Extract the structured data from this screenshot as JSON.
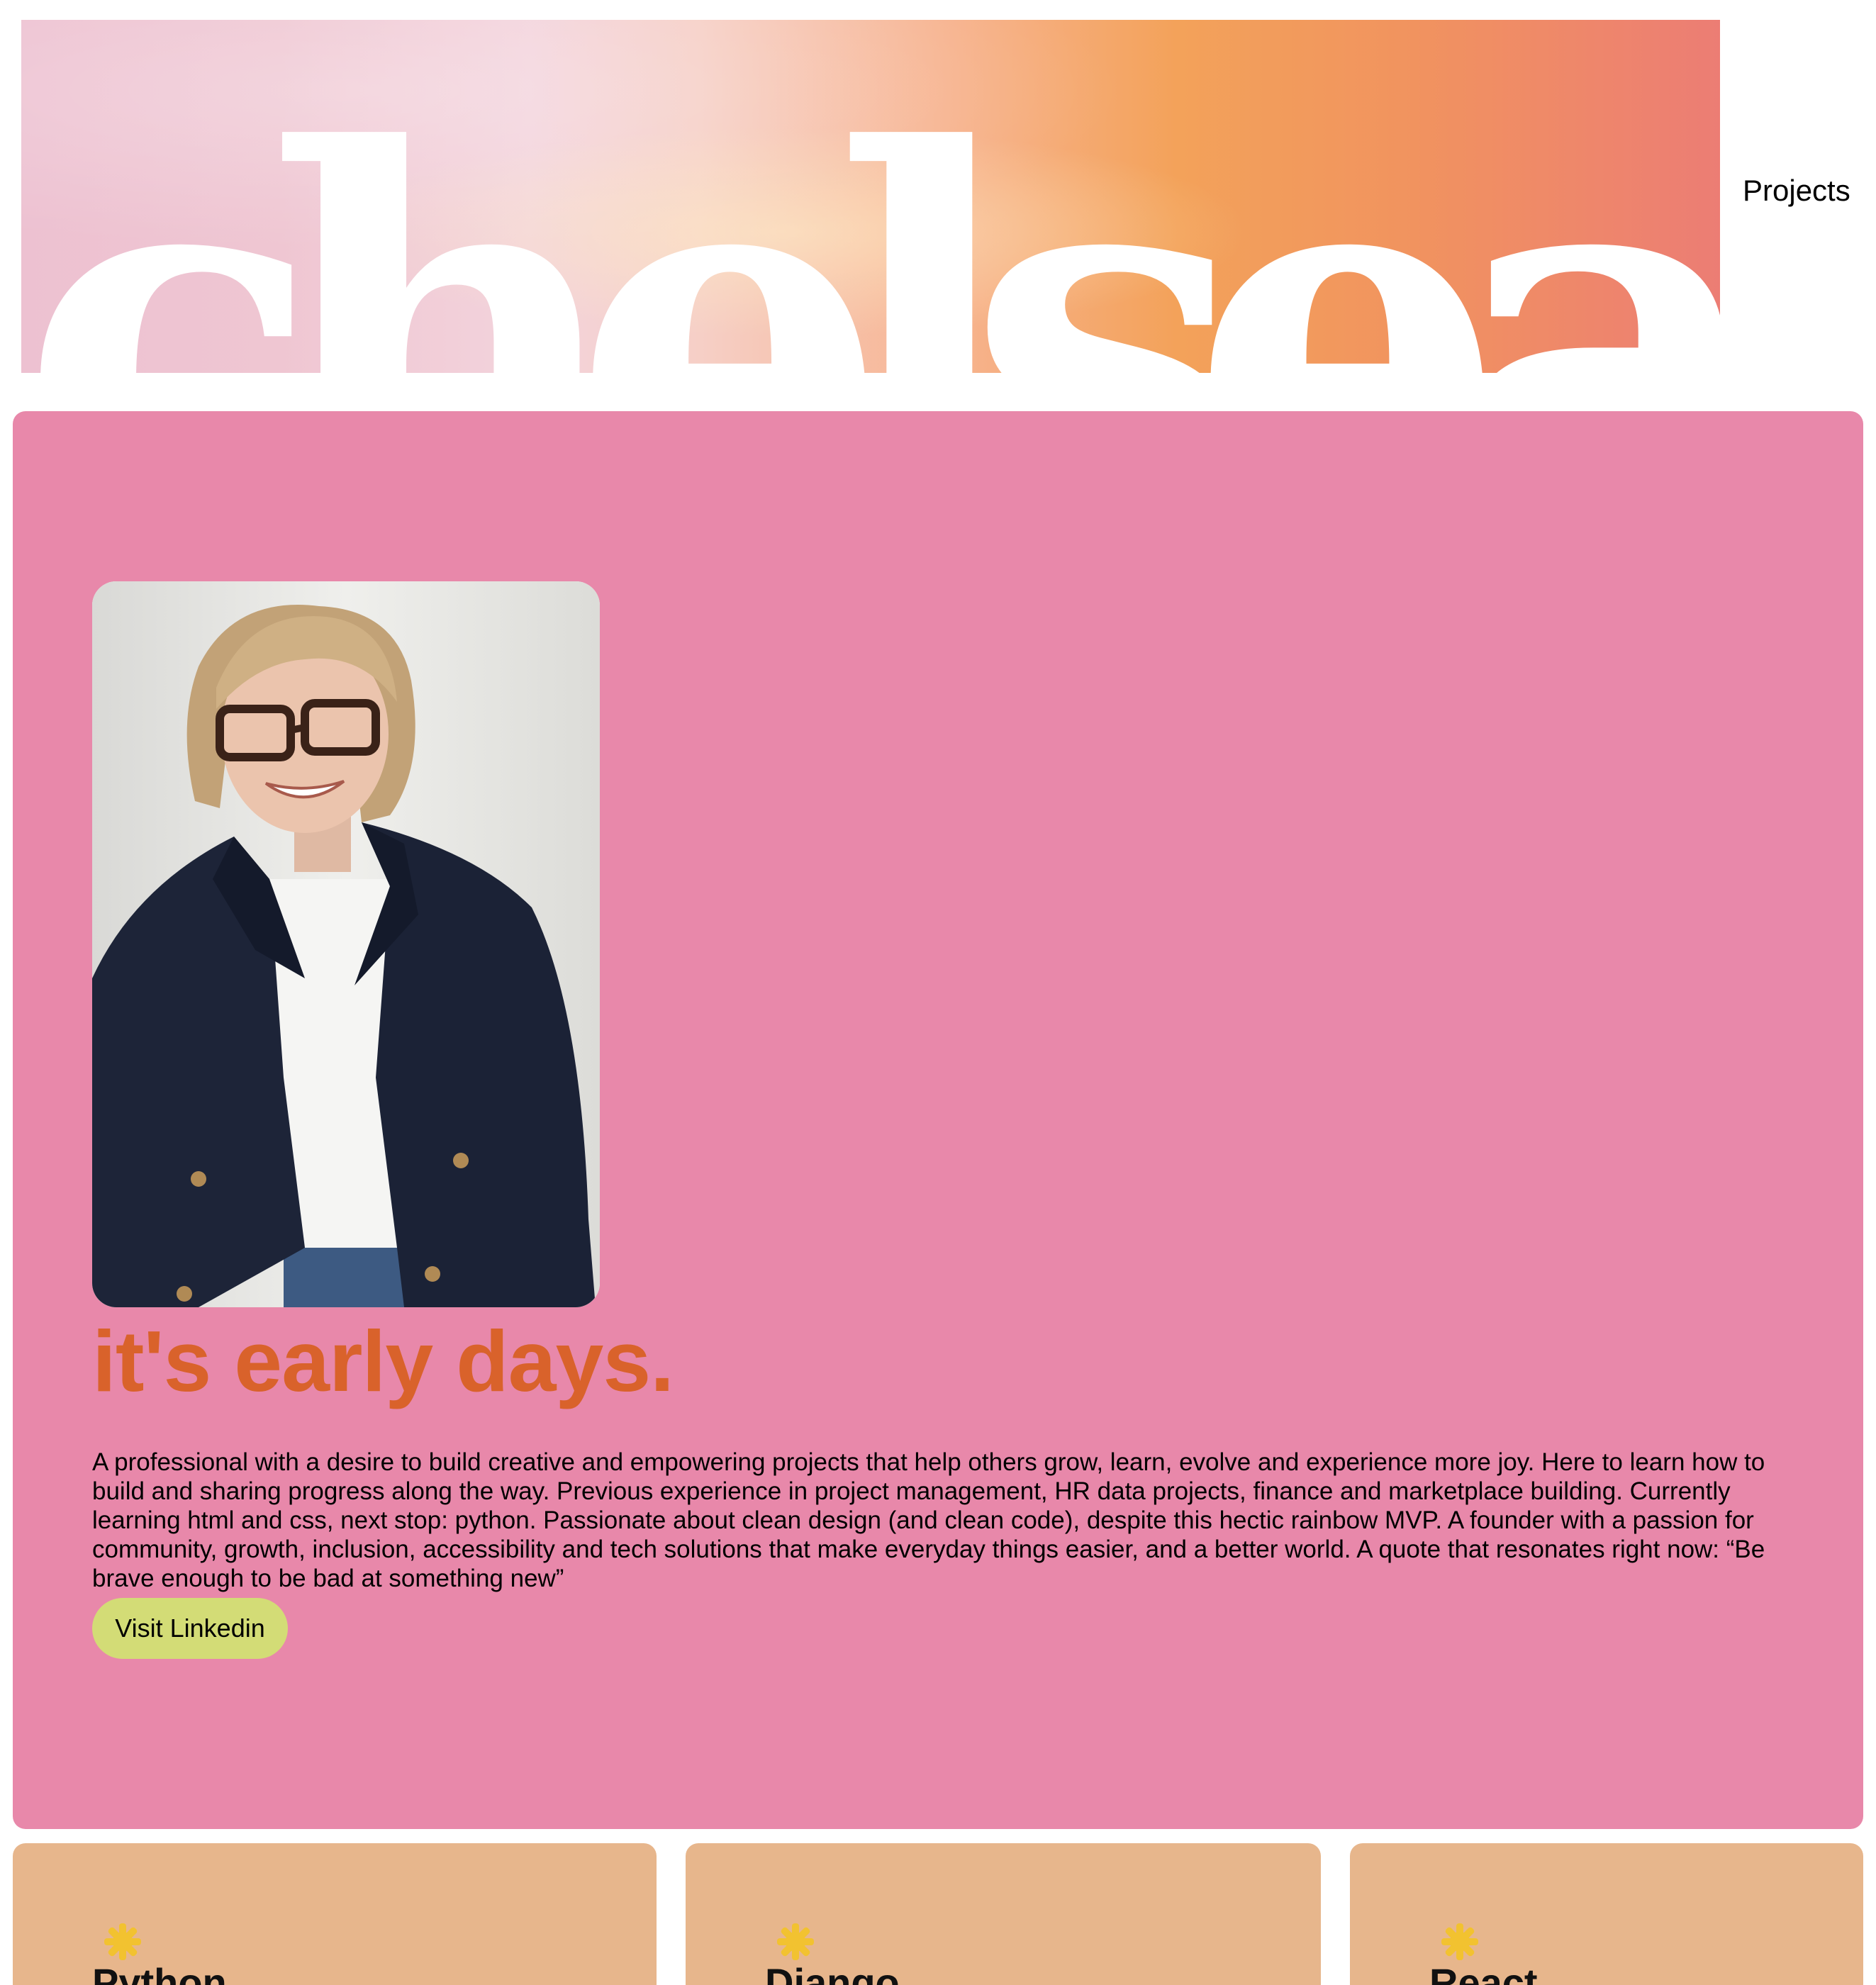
{
  "header": {
    "logo_text": "chelsea",
    "nav": {
      "projects_label": "Projects"
    }
  },
  "hero": {
    "title": "it's early days.",
    "bio": "A professional with a desire to build creative and empowering projects that help others grow, learn, evolve and experience more joy. Here to learn how to build and sharing progress along the way. Previous experience in project management, HR data projects, finance and marketplace building. Currently learning html and css, next stop: python. Passionate about clean design (and clean code), despite this hectic rainbow MVP. A founder with a passion for community, growth, inclusion, accessibility and tech solutions that make everyday things easier, and a better world. A quote that resonates right now: “Be brave enough to be bad at something new”",
    "button_label": "Visit Linkedin"
  },
  "skills": [
    {
      "title": "Python",
      "icon": "star-icon"
    },
    {
      "title": "Django",
      "icon": "star-icon"
    },
    {
      "title": "React",
      "icon": "star-icon"
    }
  ],
  "colors": {
    "hero_background": "#e888aa",
    "hero_title": "#d9622b",
    "button_background": "#d3dc76",
    "card_background": "#e7b68c",
    "star": "#f2c230"
  }
}
